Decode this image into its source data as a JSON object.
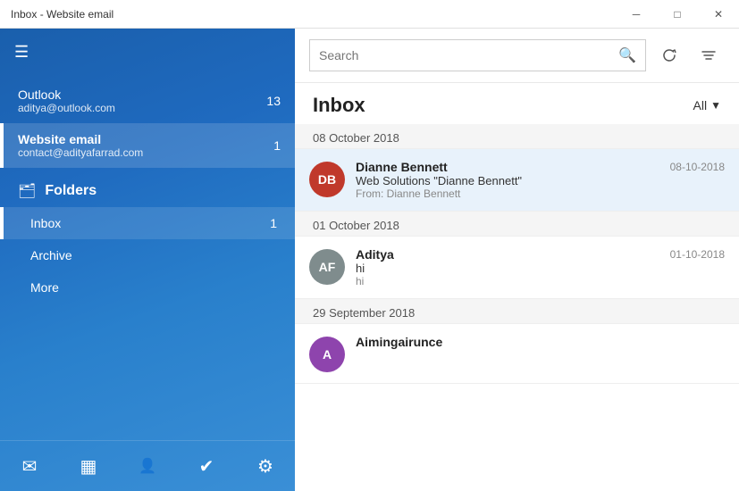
{
  "titleBar": {
    "title": "Inbox - Website email",
    "minBtn": "─",
    "maxBtn": "□",
    "closeBtn": "✕"
  },
  "sidebar": {
    "hamburgerLabel": "☰",
    "accounts": [
      {
        "name": "Outlook",
        "email": "aditya@outlook.com",
        "badge": "13",
        "bold": false,
        "active": false
      },
      {
        "name": "Website email",
        "email": "contact@adityafarrad.com",
        "badge": "1",
        "bold": true,
        "active": true
      }
    ],
    "foldersLabel": "Folders",
    "folders": [
      {
        "name": "Inbox",
        "badge": "1",
        "active": true
      },
      {
        "name": "Archive",
        "badge": "",
        "active": false
      },
      {
        "name": "More",
        "badge": "",
        "active": false
      }
    ],
    "bottomIcons": [
      "✉",
      "▦",
      "👤+",
      "✔",
      "⚙"
    ]
  },
  "rightPanel": {
    "search": {
      "placeholder": "Search",
      "searchIconLabel": "🔍"
    },
    "inboxTitle": "Inbox",
    "filterLabel": "All",
    "messages": [
      {
        "dateGroup": "08 October 2018",
        "sender": "Dianne Bennett",
        "subject": "Web Solutions \"Dianne Bennett\"",
        "preview": "From: Dianne Bennett",
        "date": "08-10-2018",
        "avatarInitials": "DB",
        "avatarColor": "#c0392b",
        "selected": true
      },
      {
        "dateGroup": "01 October 2018",
        "sender": "Aditya",
        "subject": "hi",
        "preview": "hi",
        "date": "01-10-2018",
        "avatarInitials": "AF",
        "avatarColor": "#7f8c8d",
        "selected": false
      },
      {
        "dateGroup": "29 September 2018",
        "sender": "Aimingairunce",
        "subject": "",
        "preview": "",
        "date": "",
        "avatarInitials": "A",
        "avatarColor": "#8e44ad",
        "selected": false
      }
    ]
  }
}
